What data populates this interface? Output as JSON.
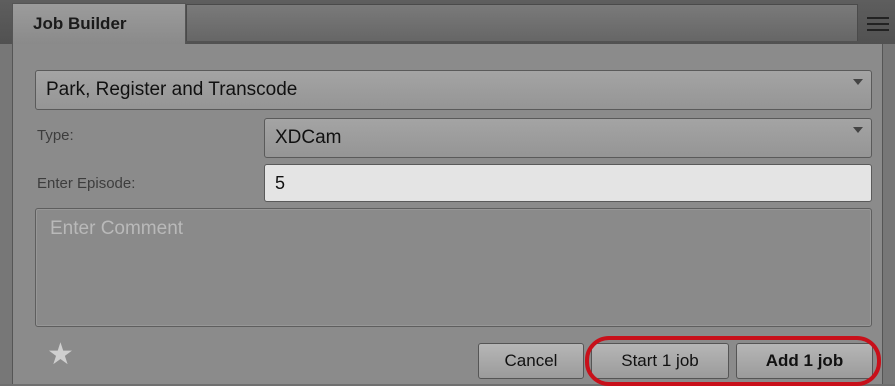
{
  "tab": {
    "title": "Job Builder"
  },
  "workflow": {
    "selected": "Park, Register and Transcode"
  },
  "type_field": {
    "label": "Type:",
    "selected": "XDCam"
  },
  "episode_field": {
    "label": "Enter Episode:",
    "value": "5"
  },
  "comment_field": {
    "placeholder": "Enter Comment"
  },
  "buttons": {
    "cancel": "Cancel",
    "start": "Start 1 job",
    "add": "Add 1 job"
  },
  "icons": {
    "menu": "hamburger-menu-icon",
    "favorite": "star-icon",
    "dropdown": "chevron-down-icon"
  },
  "colors": {
    "highlight": "#c8101a"
  }
}
